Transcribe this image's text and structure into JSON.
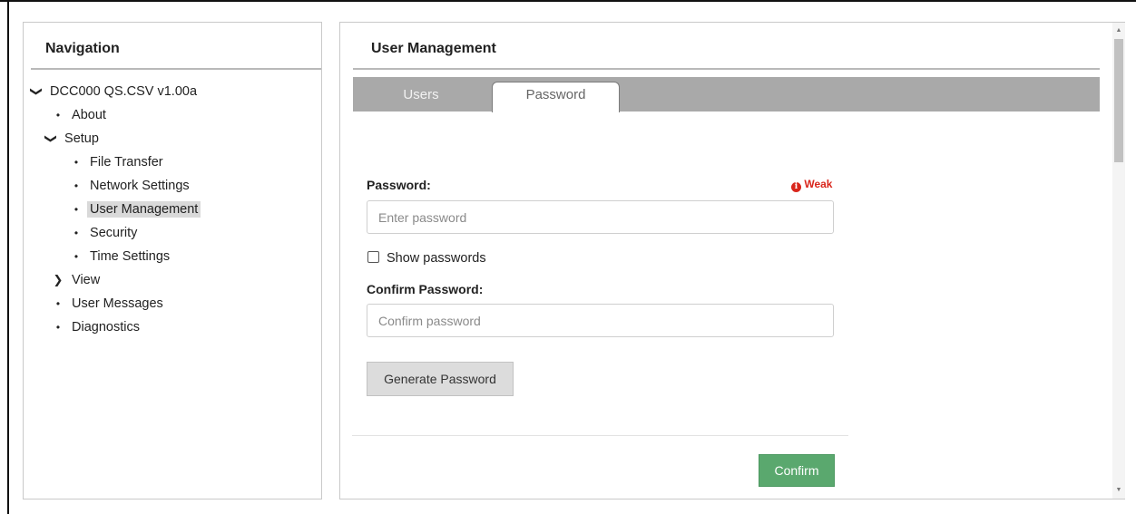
{
  "navigation": {
    "title": "Navigation",
    "items": [
      {
        "label": "DCC000 QS.CSV v1.00a",
        "marker": "❯",
        "kind": "expanded"
      },
      {
        "label": "About",
        "marker": "•",
        "kind": "leaf"
      },
      {
        "label": "Setup",
        "marker": "❯",
        "kind": "expanded"
      },
      {
        "label": "File Transfer",
        "marker": "•",
        "kind": "leaf"
      },
      {
        "label": "Network Settings",
        "marker": "•",
        "kind": "leaf"
      },
      {
        "label": "User Management",
        "marker": "•",
        "kind": "leaf",
        "active": true
      },
      {
        "label": "Security",
        "marker": "•",
        "kind": "leaf"
      },
      {
        "label": "Time Settings",
        "marker": "•",
        "kind": "leaf"
      },
      {
        "label": "View",
        "marker": "❯",
        "kind": "collapsed"
      },
      {
        "label": "User Messages",
        "marker": "•",
        "kind": "leaf"
      },
      {
        "label": "Diagnostics",
        "marker": "•",
        "kind": "leaf"
      }
    ]
  },
  "main": {
    "title": "User Management",
    "tabs": [
      {
        "label": "Users",
        "active": false
      },
      {
        "label": "Password",
        "active": true
      }
    ],
    "password": {
      "label": "Password:",
      "placeholder": "Enter password",
      "value": "",
      "strength_icon": "info-icon",
      "strength_text": "Weak"
    },
    "show_passwords": {
      "label": "Show passwords",
      "checked": false
    },
    "confirm_password": {
      "label": "Confirm Password:",
      "placeholder": "Confirm password",
      "value": ""
    },
    "generate_button": "Generate Password",
    "confirm_button": "Confirm"
  },
  "colors": {
    "tabbar": "#a9a9a9",
    "confirm_button": "#5aa86e",
    "weak_indicator": "#d9261c",
    "active_nav_item": "#d9d9d9"
  }
}
